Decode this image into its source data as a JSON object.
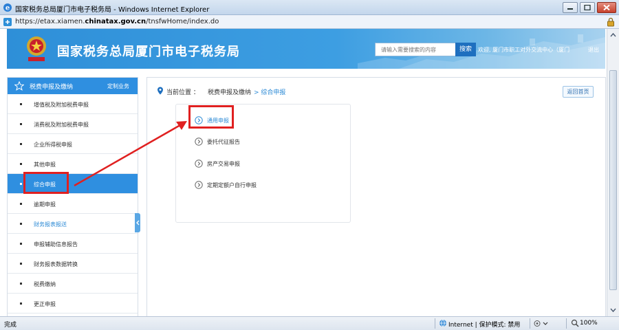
{
  "window": {
    "title": "国家税务总局厦门市电子税务局 - Windows Internet Explorer",
    "url_prefix": "https://etax.xiamen.",
    "url_domain": "chinatax.gov.cn",
    "url_path": "/tnsfwHome/index.do"
  },
  "header": {
    "site_title": "国家税务总局厦门市电子税务局",
    "search_placeholder": "请输入需要搜索的内容",
    "search_button": "搜索",
    "welcome": "欢迎, 厦门市职工对外交流中心（厦门",
    "logout": "退出",
    "colors": {
      "banner": "#2e8fd8",
      "accent": "#2f8fe0",
      "highlight": "#e02020"
    }
  },
  "sidebar": {
    "header_label": "税费申报及缴纳",
    "custom_label": "定制业务",
    "items": [
      {
        "label": "增值税及附加税费申报"
      },
      {
        "label": "消费税及附加税费申报"
      },
      {
        "label": "企业所得税申报"
      },
      {
        "label": "其他申报"
      },
      {
        "label": "综合申报"
      },
      {
        "label": "逾期申报"
      },
      {
        "label": "财务报表报送"
      },
      {
        "label": "申报辅助信息报告"
      },
      {
        "label": "财务报表数据转换"
      },
      {
        "label": "税费缴纳"
      },
      {
        "label": "更正申报"
      }
    ]
  },
  "content": {
    "location_prefix": "当前位置 ：",
    "crumb1": "税费申报及缴纳",
    "crumb2": "> 综合申报",
    "back_button": "返回首页",
    "menu": [
      {
        "label": "通用申报"
      },
      {
        "label": "委托代征报告"
      },
      {
        "label": "房产交易申报"
      },
      {
        "label": "定期定额户自行申报"
      }
    ]
  },
  "status": {
    "done": "完成",
    "zone": "Internet | 保护模式: 禁用",
    "zoom": "100%"
  }
}
